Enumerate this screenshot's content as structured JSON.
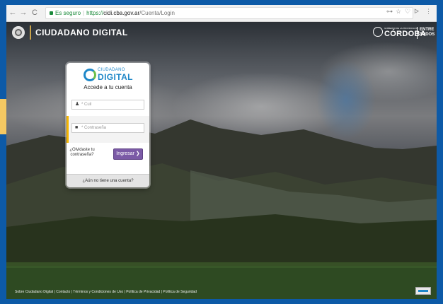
{
  "browser": {
    "back": "←",
    "forward": "→",
    "reload": "C",
    "secure_label": "Es seguro",
    "url_protocol": "https://",
    "url_host": "cidi.cba.gov.ar",
    "url_path": "/Cuenta/Login",
    "ext_icons": [
      "⊶",
      "☆",
      "♡",
      "ᐅ",
      "⋮"
    ]
  },
  "header": {
    "app_name": "CIUDADANO DIGITAL",
    "gov_small": "GOBIERNO DE LA PROVINCIA DE",
    "gov_name": "CÓRDOBA",
    "slogan_line1": "ENTRE",
    "slogan_line2": "TODOS"
  },
  "login": {
    "logo_small": "CIUDADANO",
    "logo_big": "DIGITAL",
    "title": "Accede a tu cuenta",
    "cuil_placeholder": "* Cuil",
    "password_placeholder": "* Contraseña",
    "forgot_line1": "¿Olvidaste tu",
    "forgot_line2": "contraseña?",
    "submit_label": "Ingresar ❯",
    "register_label": "¿Aún no tiene una cuenta?"
  },
  "footer": {
    "text": "Sobre Ciudadano Digital | Contacto | Términos y Condiciones de Uso | Política de Privacidad | Política de Seguridad"
  }
}
